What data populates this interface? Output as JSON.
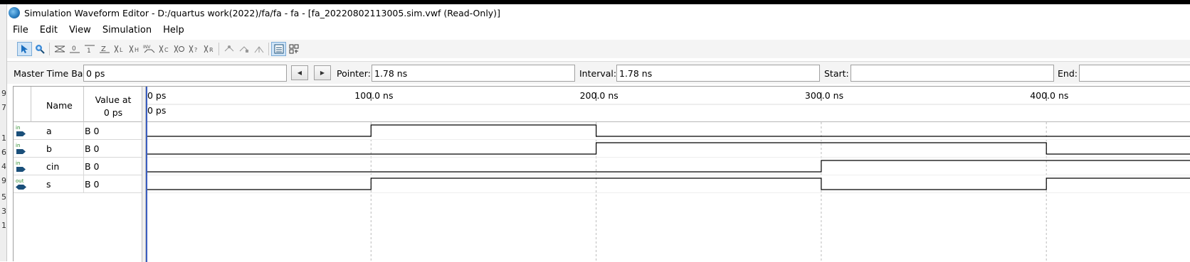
{
  "window": {
    "title": "Simulation Waveform Editor - D:/quartus work(2022)/fa/fa - fa - [fa_20220802113005.sim.vwf (Read-Only)]"
  },
  "left_strip_digits": [
    "9",
    "7",
    "1",
    "6",
    "4",
    "9",
    "5",
    "3",
    "1"
  ],
  "menu": [
    "File",
    "Edit",
    "View",
    "Simulation",
    "Help"
  ],
  "toolbar": {
    "icons": [
      "selection-tool-icon",
      "zoom-tool-icon",
      "forcing-unknown-icon",
      "forcing-low-icon",
      "forcing-high-icon",
      "high-impedance-icon",
      "weak-low-icon",
      "weak-high-icon",
      "invert-icon",
      "count-value-icon",
      "clock-icon",
      "arbitrary-value-icon",
      "random-value-icon",
      "snap-to-grid-icon",
      "grid-options-icon",
      "align-icon",
      "settings-icon",
      "waveform-view-icon",
      "split-view-icon"
    ]
  },
  "timebar": {
    "master_label": "Master Time Bar:",
    "master_value": "0 ps",
    "pointer_label": "Pointer:",
    "pointer_value": "1.78 ns",
    "interval_label": "Interval:",
    "interval_value": "1.78 ns",
    "start_label": "Start:",
    "start_value": "",
    "end_label": "End:",
    "end_value": ""
  },
  "signal_table": {
    "header_name": "Name",
    "header_value_line1": "Value at",
    "header_value_line2": "0 ps",
    "signals": [
      {
        "direction": "in",
        "name": "a",
        "value": "B 0"
      },
      {
        "direction": "in",
        "name": "b",
        "value": "B 0"
      },
      {
        "direction": "in",
        "name": "cin",
        "value": "B 0"
      },
      {
        "direction": "out",
        "name": "s",
        "value": "B 0"
      }
    ]
  },
  "waveform": {
    "time_unit": "ns",
    "ticks": [
      "0 ps",
      "100.0 ns",
      "200.0 ns",
      "300.0 ns",
      "400.0 ns"
    ],
    "tick_times_ns": [
      0,
      100,
      200,
      300,
      400
    ],
    "cursor_label": "0 ps",
    "visible_end_ns": 464,
    "waves": [
      {
        "name": "a",
        "transitions_ns": [
          0,
          100,
          200
        ],
        "levels": [
          0,
          1,
          0
        ]
      },
      {
        "name": "b",
        "transitions_ns": [
          0,
          200,
          400
        ],
        "levels": [
          0,
          1,
          0
        ]
      },
      {
        "name": "cin",
        "transitions_ns": [
          0,
          300
        ],
        "levels": [
          0,
          1
        ]
      },
      {
        "name": "s",
        "transitions_ns": [
          0,
          100,
          300,
          400
        ],
        "levels": [
          0,
          1,
          0,
          1
        ]
      }
    ]
  },
  "colors": {
    "background": "#ffffff",
    "toolbar_bg": "#f4f4f4",
    "gridline": "#bbbbbb",
    "cursor": "#3a5ec0",
    "port_icon": "#1a4f7a"
  }
}
